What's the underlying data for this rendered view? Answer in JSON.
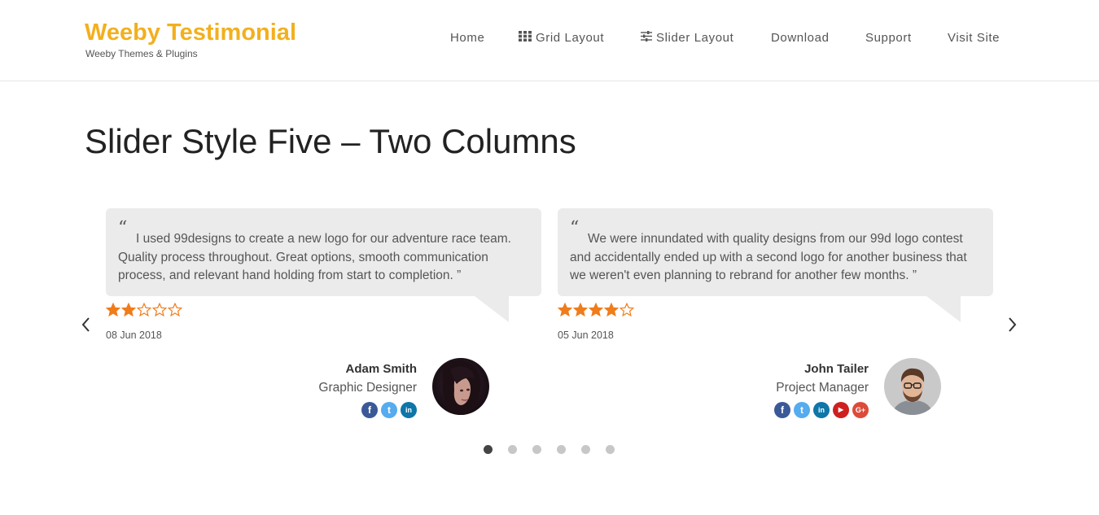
{
  "header": {
    "brand_title": "Weeby Testimonial",
    "brand_subtitle": "Weeby Themes & Plugins",
    "brand_color": "#f2b01e"
  },
  "nav": {
    "items": [
      {
        "label": "Home",
        "icon": ""
      },
      {
        "label": "Grid Layout",
        "icon": "grid-icon"
      },
      {
        "label": "Slider Layout",
        "icon": "sliders-icon"
      },
      {
        "label": "Download",
        "icon": ""
      },
      {
        "label": "Support",
        "icon": ""
      },
      {
        "label": "Visit Site",
        "icon": ""
      }
    ]
  },
  "page": {
    "title": "Slider Style Five – Two Columns"
  },
  "testimonials": [
    {
      "quote_open": "“",
      "quote": "I used 99designs to create a new logo for our adventure race team. Quality process throughout. Great options, smooth communication process, and relevant hand holding from start to completion. ”",
      "rating": 2,
      "rating_max": 5,
      "date": "08 Jun 2018",
      "name": "Adam Smith",
      "role": "Graphic Designer",
      "socials": [
        "facebook-icon",
        "twitter-icon",
        "linkedin-icon"
      ]
    },
    {
      "quote_open": "“",
      "quote": "We were innundated with quality designs from our 99d logo contest and accidentally ended up with a second logo for another business that we weren't even planning to rebrand for another few months. ”",
      "rating": 4,
      "rating_max": 5,
      "date": "05 Jun 2018",
      "name": "John Tailer",
      "role": "Project Manager",
      "socials": [
        "facebook-icon",
        "twitter-icon",
        "linkedin-icon",
        "youtube-icon",
        "google-plus-icon"
      ]
    }
  ],
  "slider": {
    "dot_count": 6,
    "active_dot": 1
  },
  "colors": {
    "star": "#f07c1b",
    "bubble": "#ebebeb",
    "facebook": "#3b5998",
    "twitter": "#55acee",
    "linkedin": "#0e76a8",
    "youtube": "#cd201f",
    "google_plus": "#dd4b39"
  }
}
